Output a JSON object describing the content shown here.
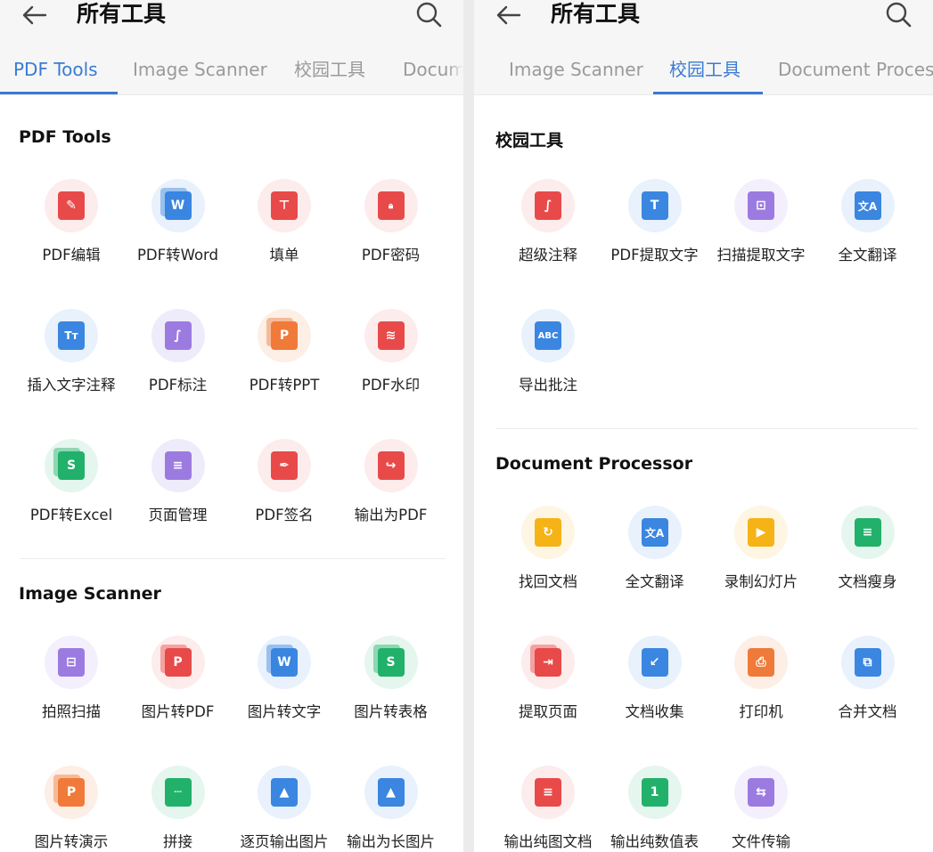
{
  "colors": {
    "accent": "#3a7bd5",
    "red": "#e84a4a",
    "blue": "#3a86e0",
    "orange": "#f07a3a",
    "green": "#22b16a",
    "purple": "#9c7be0",
    "yellow": "#f5b316"
  },
  "left_panel": {
    "title": "所有工具",
    "tabs": [
      {
        "label": "PDF Tools",
        "active": true
      },
      {
        "label": "Image Scanner",
        "active": false
      },
      {
        "label": "校园工具",
        "active": false
      },
      {
        "label": "Docum",
        "active": false
      }
    ],
    "sections": [
      {
        "title": "PDF Tools",
        "tools": [
          {
            "label": "PDF编辑",
            "icon": "pdf-edit-icon"
          },
          {
            "label": "PDF转Word",
            "icon": "pdf-to-word-icon"
          },
          {
            "label": "填单",
            "icon": "fill-form-icon"
          },
          {
            "label": "PDF密码",
            "icon": "lock-icon"
          },
          {
            "label": "插入文字注释",
            "icon": "text-annotation-icon"
          },
          {
            "label": "PDF标注",
            "icon": "pdf-markup-icon"
          },
          {
            "label": "PDF转PPT",
            "icon": "pdf-to-ppt-icon"
          },
          {
            "label": "PDF水印",
            "icon": "watermark-icon"
          },
          {
            "label": "PDF转Excel",
            "icon": "pdf-to-excel-icon"
          },
          {
            "label": "页面管理",
            "icon": "page-manage-icon"
          },
          {
            "label": "PDF签名",
            "icon": "signature-icon"
          },
          {
            "label": "输出为PDF",
            "icon": "export-pdf-icon"
          }
        ]
      },
      {
        "title": "Image Scanner",
        "tools": [
          {
            "label": "拍照扫描",
            "icon": "scan-icon"
          },
          {
            "label": "图片转PDF",
            "icon": "image-to-pdf-icon"
          },
          {
            "label": "图片转文字",
            "icon": "image-to-text-icon"
          },
          {
            "label": "图片转表格",
            "icon": "image-to-table-icon"
          },
          {
            "label": "图片转演示",
            "icon": "image-to-slides-icon"
          },
          {
            "label": "拼接",
            "icon": "stitch-icon"
          },
          {
            "label": "逐页输出图片",
            "icon": "export-page-images-icon"
          },
          {
            "label": "输出为长图片",
            "icon": "export-long-image-icon"
          }
        ]
      }
    ]
  },
  "right_panel": {
    "title": "所有工具",
    "tabs": [
      {
        "label": "Image Scanner",
        "active": false
      },
      {
        "label": "校园工具",
        "active": true
      },
      {
        "label": "Document Proces",
        "active": false
      }
    ],
    "sections": [
      {
        "title": "校园工具",
        "tools": [
          {
            "label": "超级注释",
            "icon": "super-annotation-icon"
          },
          {
            "label": "PDF提取文字",
            "icon": "pdf-extract-text-icon"
          },
          {
            "label": "扫描提取文字",
            "icon": "scan-extract-text-icon"
          },
          {
            "label": "全文翻译",
            "icon": "translate-icon"
          },
          {
            "label": "导出批注",
            "icon": "export-annotations-icon"
          }
        ]
      },
      {
        "title": "Document Processor",
        "tools": [
          {
            "label": "找回文档",
            "icon": "recover-document-icon"
          },
          {
            "label": "全文翻译",
            "icon": "translate-icon"
          },
          {
            "label": "录制幻灯片",
            "icon": "record-slides-icon"
          },
          {
            "label": "文档瘦身",
            "icon": "compress-document-icon"
          },
          {
            "label": "提取页面",
            "icon": "extract-pages-icon"
          },
          {
            "label": "文档收集",
            "icon": "collect-documents-icon"
          },
          {
            "label": "打印机",
            "icon": "printer-icon"
          },
          {
            "label": "合并文档",
            "icon": "merge-documents-icon"
          },
          {
            "label": "输出纯图文档",
            "icon": "export-image-document-icon"
          },
          {
            "label": "输出纯数值表",
            "icon": "export-values-table-icon"
          },
          {
            "label": "文件传输",
            "icon": "file-transfer-icon"
          }
        ]
      }
    ]
  }
}
